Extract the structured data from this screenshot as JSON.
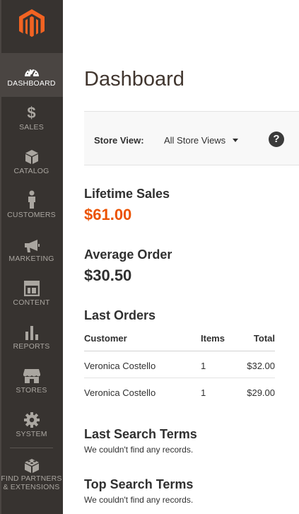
{
  "sidebar": {
    "items": [
      {
        "label": "DASHBOARD",
        "icon": "speedometer-icon",
        "active": true
      },
      {
        "label": "SALES",
        "icon": "dollar-icon",
        "active": false
      },
      {
        "label": "CATALOG",
        "icon": "box-icon",
        "active": false
      },
      {
        "label": "CUSTOMERS",
        "icon": "person-icon",
        "active": false
      },
      {
        "label": "MARKETING",
        "icon": "megaphone-icon",
        "active": false
      },
      {
        "label": "CONTENT",
        "icon": "layout-icon",
        "active": false
      },
      {
        "label": "REPORTS",
        "icon": "bar-chart-icon",
        "active": false
      },
      {
        "label": "STORES",
        "icon": "storefront-icon",
        "active": false
      },
      {
        "label": "SYSTEM",
        "icon": "gear-icon",
        "active": false
      }
    ],
    "partners_line1": "FIND PARTNERS",
    "partners_line2": "& EXTENSIONS"
  },
  "page": {
    "title": "Dashboard"
  },
  "store_view": {
    "label": "Store View:",
    "selected": "All Store Views",
    "help": "?"
  },
  "lifetime_sales": {
    "title": "Lifetime Sales",
    "value": "$61.00"
  },
  "average_order": {
    "title": "Average Order",
    "value": "$30.50"
  },
  "last_orders": {
    "title": "Last Orders",
    "columns": {
      "customer": "Customer",
      "items": "Items",
      "total": "Total"
    },
    "rows": [
      {
        "customer": "Veronica Costello",
        "items": "1",
        "total": "$32.00"
      },
      {
        "customer": "Veronica Costello",
        "items": "1",
        "total": "$29.00"
      }
    ]
  },
  "last_search_terms": {
    "title": "Last Search Terms",
    "empty": "We couldn't find any records."
  },
  "top_search_terms": {
    "title": "Top Search Terms",
    "empty": "We couldn't find any records."
  },
  "colors": {
    "accent": "#eb5202",
    "sidebar": "#373330",
    "sidebar_active": "#4a4542"
  }
}
